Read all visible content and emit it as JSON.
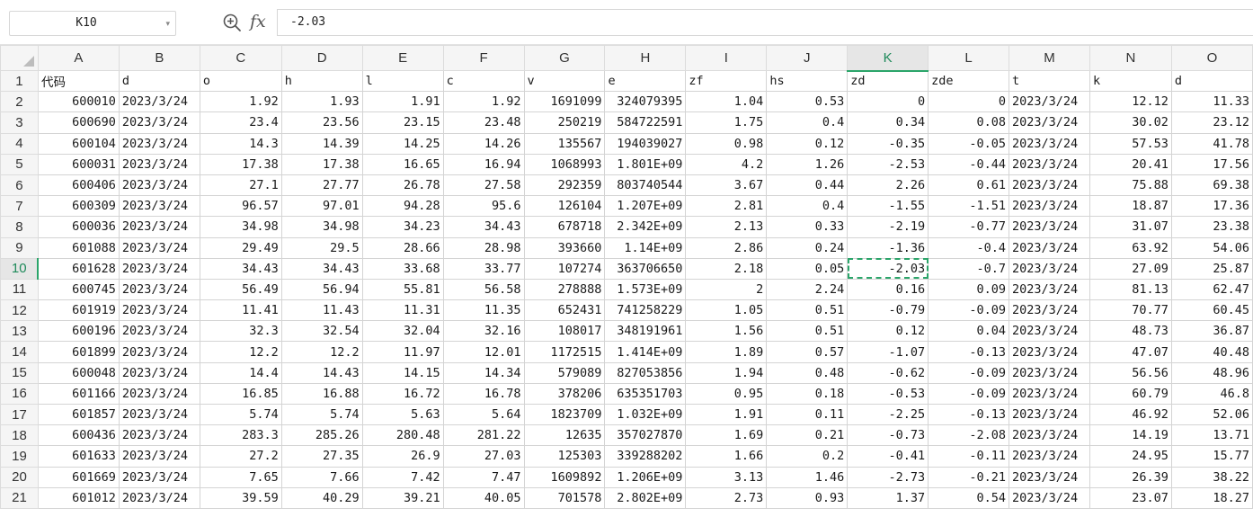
{
  "formula_bar": {
    "name_box": "K10",
    "zoom_icon": "zoom-in-icon",
    "fx_label": "fx",
    "formula": "-2.03"
  },
  "sheet": {
    "selected_cell": "K10",
    "active_column": "K",
    "active_row": "10",
    "columns": [
      "A",
      "B",
      "C",
      "D",
      "E",
      "F",
      "G",
      "H",
      "I",
      "J",
      "K",
      "L",
      "M",
      "N",
      "O"
    ],
    "column_widths": [
      90,
      90,
      91,
      90,
      90,
      90,
      90,
      90,
      90,
      90,
      90,
      90,
      90,
      91,
      90
    ],
    "rows": [
      {
        "num": "1",
        "cells": [
          "代码",
          "d",
          "o",
          "h",
          "l",
          "c",
          "v",
          "e",
          "zf",
          "hs",
          "zd",
          "zde",
          "t",
          "k",
          "d"
        ]
      },
      {
        "num": "2",
        "cells": [
          "600010",
          "2023/3/24",
          "1.92",
          "1.93",
          "1.91",
          "1.92",
          "1691099",
          "324079395",
          "1.04",
          "0.53",
          "0",
          "0",
          "2023/3/24",
          "12.12",
          "11.33"
        ]
      },
      {
        "num": "3",
        "cells": [
          "600690",
          "2023/3/24",
          "23.4",
          "23.56",
          "23.15",
          "23.48",
          "250219",
          "584722591",
          "1.75",
          "0.4",
          "0.34",
          "0.08",
          "2023/3/24",
          "30.02",
          "23.12"
        ]
      },
      {
        "num": "4",
        "cells": [
          "600104",
          "2023/3/24",
          "14.3",
          "14.39",
          "14.25",
          "14.26",
          "135567",
          "194039027",
          "0.98",
          "0.12",
          "-0.35",
          "-0.05",
          "2023/3/24",
          "57.53",
          "41.78"
        ]
      },
      {
        "num": "5",
        "cells": [
          "600031",
          "2023/3/24",
          "17.38",
          "17.38",
          "16.65",
          "16.94",
          "1068993",
          "1.801E+09",
          "4.2",
          "1.26",
          "-2.53",
          "-0.44",
          "2023/3/24",
          "20.41",
          "17.56"
        ]
      },
      {
        "num": "6",
        "cells": [
          "600406",
          "2023/3/24",
          "27.1",
          "27.77",
          "26.78",
          "27.58",
          "292359",
          "803740544",
          "3.67",
          "0.44",
          "2.26",
          "0.61",
          "2023/3/24",
          "75.88",
          "69.38"
        ]
      },
      {
        "num": "7",
        "cells": [
          "600309",
          "2023/3/24",
          "96.57",
          "97.01",
          "94.28",
          "95.6",
          "126104",
          "1.207E+09",
          "2.81",
          "0.4",
          "-1.55",
          "-1.51",
          "2023/3/24",
          "18.87",
          "17.36"
        ]
      },
      {
        "num": "8",
        "cells": [
          "600036",
          "2023/3/24",
          "34.98",
          "34.98",
          "34.23",
          "34.43",
          "678718",
          "2.342E+09",
          "2.13",
          "0.33",
          "-2.19",
          "-0.77",
          "2023/3/24",
          "31.07",
          "23.38"
        ]
      },
      {
        "num": "9",
        "cells": [
          "601088",
          "2023/3/24",
          "29.49",
          "29.5",
          "28.66",
          "28.98",
          "393660",
          "1.14E+09",
          "2.86",
          "0.24",
          "-1.36",
          "-0.4",
          "2023/3/24",
          "63.92",
          "54.06"
        ]
      },
      {
        "num": "10",
        "cells": [
          "601628",
          "2023/3/24",
          "34.43",
          "34.43",
          "33.68",
          "33.77",
          "107274",
          "363706650",
          "2.18",
          "0.05",
          "-2.03",
          "-0.7",
          "2023/3/24",
          "27.09",
          "25.87"
        ]
      },
      {
        "num": "11",
        "cells": [
          "600745",
          "2023/3/24",
          "56.49",
          "56.94",
          "55.81",
          "56.58",
          "278888",
          "1.573E+09",
          "2",
          "2.24",
          "0.16",
          "0.09",
          "2023/3/24",
          "81.13",
          "62.47"
        ]
      },
      {
        "num": "12",
        "cells": [
          "601919",
          "2023/3/24",
          "11.41",
          "11.43",
          "11.31",
          "11.35",
          "652431",
          "741258229",
          "1.05",
          "0.51",
          "-0.79",
          "-0.09",
          "2023/3/24",
          "70.77",
          "60.45"
        ]
      },
      {
        "num": "13",
        "cells": [
          "600196",
          "2023/3/24",
          "32.3",
          "32.54",
          "32.04",
          "32.16",
          "108017",
          "348191961",
          "1.56",
          "0.51",
          "0.12",
          "0.04",
          "2023/3/24",
          "48.73",
          "36.87"
        ]
      },
      {
        "num": "14",
        "cells": [
          "601899",
          "2023/3/24",
          "12.2",
          "12.2",
          "11.97",
          "12.01",
          "1172515",
          "1.414E+09",
          "1.89",
          "0.57",
          "-1.07",
          "-0.13",
          "2023/3/24",
          "47.07",
          "40.48"
        ]
      },
      {
        "num": "15",
        "cells": [
          "600048",
          "2023/3/24",
          "14.4",
          "14.43",
          "14.15",
          "14.34",
          "579089",
          "827053856",
          "1.94",
          "0.48",
          "-0.62",
          "-0.09",
          "2023/3/24",
          "56.56",
          "48.96"
        ]
      },
      {
        "num": "16",
        "cells": [
          "601166",
          "2023/3/24",
          "16.85",
          "16.88",
          "16.72",
          "16.78",
          "378206",
          "635351703",
          "0.95",
          "0.18",
          "-0.53",
          "-0.09",
          "2023/3/24",
          "60.79",
          "46.8"
        ]
      },
      {
        "num": "17",
        "cells": [
          "601857",
          "2023/3/24",
          "5.74",
          "5.74",
          "5.63",
          "5.64",
          "1823709",
          "1.032E+09",
          "1.91",
          "0.11",
          "-2.25",
          "-0.13",
          "2023/3/24",
          "46.92",
          "52.06"
        ]
      },
      {
        "num": "18",
        "cells": [
          "600436",
          "2023/3/24",
          "283.3",
          "285.26",
          "280.48",
          "281.22",
          "12635",
          "357027870",
          "1.69",
          "0.21",
          "-0.73",
          "-2.08",
          "2023/3/24",
          "14.19",
          "13.71"
        ]
      },
      {
        "num": "19",
        "cells": [
          "601633",
          "2023/3/24",
          "27.2",
          "27.35",
          "26.9",
          "27.03",
          "125303",
          "339288202",
          "1.66",
          "0.2",
          "-0.41",
          "-0.11",
          "2023/3/24",
          "24.95",
          "15.77"
        ]
      },
      {
        "num": "20",
        "cells": [
          "601669",
          "2023/3/24",
          "7.65",
          "7.66",
          "7.42",
          "7.47",
          "1609892",
          "1.206E+09",
          "3.13",
          "1.46",
          "-2.73",
          "-0.21",
          "2023/3/24",
          "26.39",
          "38.22"
        ]
      },
      {
        "num": "21",
        "cells": [
          "601012",
          "2023/3/24",
          "39.59",
          "40.29",
          "39.21",
          "40.05",
          "701578",
          "2.802E+09",
          "2.73",
          "0.93",
          "1.37",
          "0.54",
          "2023/3/24",
          "23.07",
          "18.27"
        ]
      }
    ]
  },
  "colors": {
    "active_accent": "#2ba56a",
    "header_bg": "#f5f5f5",
    "grid_line": "#d4d4d4"
  }
}
